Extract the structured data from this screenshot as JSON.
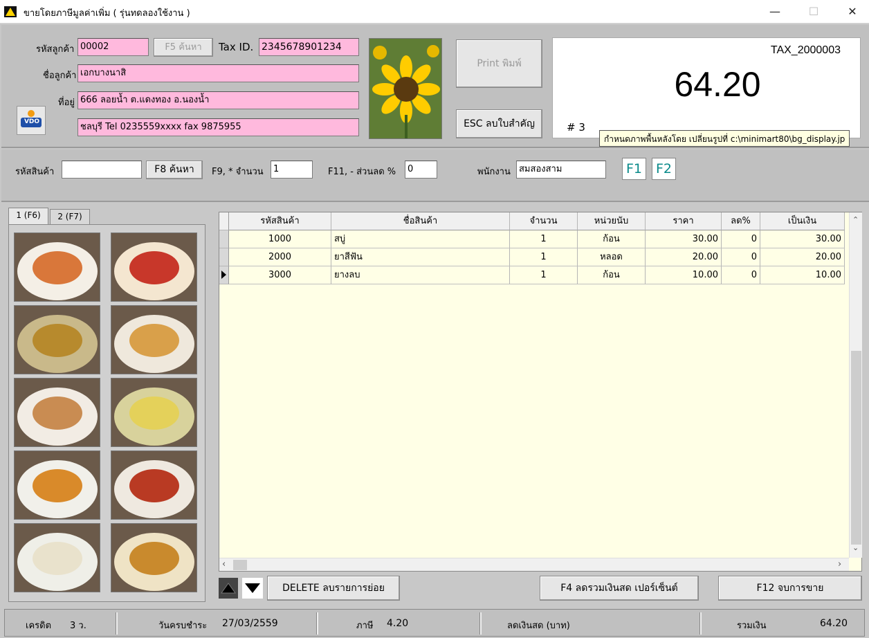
{
  "window": {
    "title": "ขายโดยภาษีมูลค่าเพิ่ม ( รุ่นทดลองใช้งาน )",
    "controls": {
      "minimize": "—",
      "maximize": "☐",
      "close": "✕"
    }
  },
  "customer": {
    "code_label": "รหัสลูกค้า",
    "code": "00002",
    "search_button": "F5 ค้นหา",
    "taxid_label": "Tax ID.",
    "taxid": "2345678901234",
    "name_label": "ชื่อลูกค้า",
    "name": "เอกบางนาสิ",
    "address_label": "ที่อยู่",
    "address1": "666 ลอยน้ำ ต.แดงทอง  อ.นองน้ำ",
    "address2": "ชลบุรี Tel 0235559xxxx fax 9875955",
    "logo_text": "VDO"
  },
  "actions": {
    "print": "Print พิมพ์",
    "esc": "ESC ลบใบสำคัญ"
  },
  "display": {
    "doc_no": "TAX_2000003",
    "total": "64.20",
    "counter": "# 3",
    "tooltip": "กำหนดภาพพื้นหลังโดย เปลี่ยนรูปที่  c:\\minimart80\\bg_display.jp"
  },
  "entry": {
    "product_label": "รหัสสินค้า",
    "product_value": "",
    "search_button": "F8 ค้นหา",
    "qty_label": "F9, * จำนวน",
    "qty_value": "1",
    "discount_label": "F11, - ส่วนลด %",
    "discount_value": "0",
    "staff_label": "พนักงาน",
    "staff_value": "สมสองสาม",
    "f1": "F1",
    "f2": "F2"
  },
  "tabs": [
    {
      "label": "1 (F6)",
      "active": true
    },
    {
      "label": "2 (F7)",
      "active": false
    }
  ],
  "food_images": [
    "food-1",
    "food-2",
    "food-3",
    "food-4",
    "food-5",
    "food-6",
    "food-7",
    "food-8",
    "food-9",
    "food-10"
  ],
  "grid": {
    "headers": {
      "code": "รหัสสินค้า",
      "name": "ชื่อสินค้า",
      "qty": "จำนวน",
      "unit": "หน่วยนับ",
      "price": "ราคา",
      "disc": "ลด%",
      "amount": "เป็นเงิน"
    },
    "rows": [
      {
        "code": "1000",
        "name": "สบู่",
        "qty": "1",
        "unit": "ก้อน",
        "price": "30.00",
        "disc": "0",
        "amount": "30.00"
      },
      {
        "code": "2000",
        "name": "ยาสีฟัน",
        "qty": "1",
        "unit": "หลอด",
        "price": "20.00",
        "disc": "0",
        "amount": "20.00"
      },
      {
        "code": "3000",
        "name": "ยางลบ",
        "qty": "1",
        "unit": "ก้อน",
        "price": "10.00",
        "disc": "0",
        "amount": "10.00"
      }
    ],
    "selected_row": 2
  },
  "bottom": {
    "delete_button": "DELETE  ลบรายการย่อย",
    "f4_button": "F4  ลดรวมเงินสด เปอร์เซ็นต์",
    "f12_button": "F12  จบการขาย"
  },
  "status": {
    "credit_label": "เครดิต",
    "credit_value": "3 ว.",
    "due_label": "วันครบชำระ",
    "due_value": "27/03/2559",
    "tax_label": "ภาษี",
    "tax_value": "4.20",
    "cash_disc_label": "ลดเงินสด (บาท)",
    "total_label": "รวมเงิน",
    "total_value": "64.20"
  },
  "colors": {
    "pink_field": "#ffb9dd",
    "grid_bg": "#ffffe6",
    "fkey_text": "#0a8a8a"
  }
}
